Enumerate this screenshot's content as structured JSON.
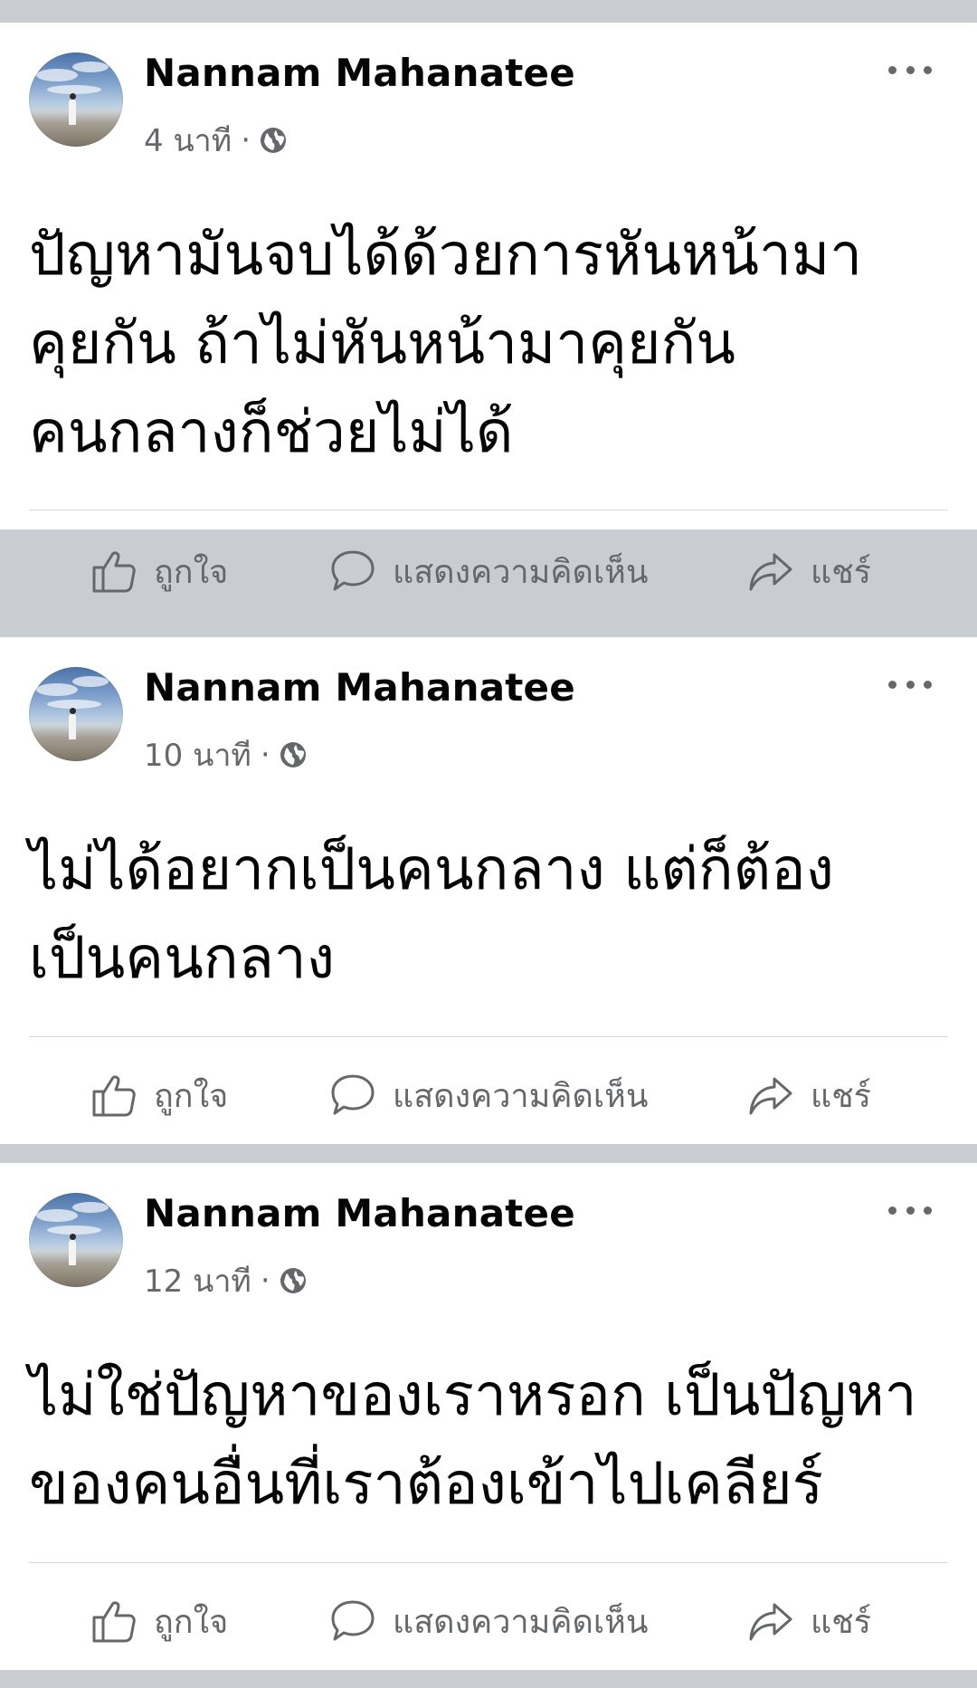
{
  "posts": [
    {
      "author": "Nannam Mahanatee",
      "time": "4 นาที",
      "separator": "·",
      "audience_icon": "globe-icon",
      "text_lines": [
        "ปัญหามันจบได้ด้วยการหันหน้ามา",
        "คุยกัน ถ้าไม่หันหน้ามาคุยกัน",
        "คนกลางก็ช่วยไม่ได้"
      ],
      "actions": {
        "like": "ถูกใจ",
        "comment": "แสดงความคิดเห็น",
        "share": "แชร์"
      }
    },
    {
      "author": "Nannam Mahanatee",
      "time": "10 นาที",
      "separator": "·",
      "audience_icon": "globe-icon",
      "text_lines": [
        "ไม่ได้อยากเป็นคนกลาง แต่ก็ต้อง",
        "เป็นคนกลาง"
      ],
      "actions": {
        "like": "ถูกใจ",
        "comment": "แสดงความคิดเห็น",
        "share": "แชร์"
      }
    },
    {
      "author": "Nannam Mahanatee",
      "time": "12 นาที",
      "separator": "·",
      "audience_icon": "globe-icon",
      "text_lines": [
        "ไม่ใช่ปัญหาของเราหรอก เป็นปัญหา",
        "ของคนอื่นที่เราต้องเข้าไปเคลียร์"
      ],
      "actions": {
        "like": "ถูกใจ",
        "comment": "แสดงความคิดเห็น",
        "share": "แชร์"
      }
    }
  ],
  "colors": {
    "feed_background": "#c9ccd1",
    "card_background": "#ffffff",
    "primary_text": "#050505",
    "secondary_text": "#65676b"
  }
}
